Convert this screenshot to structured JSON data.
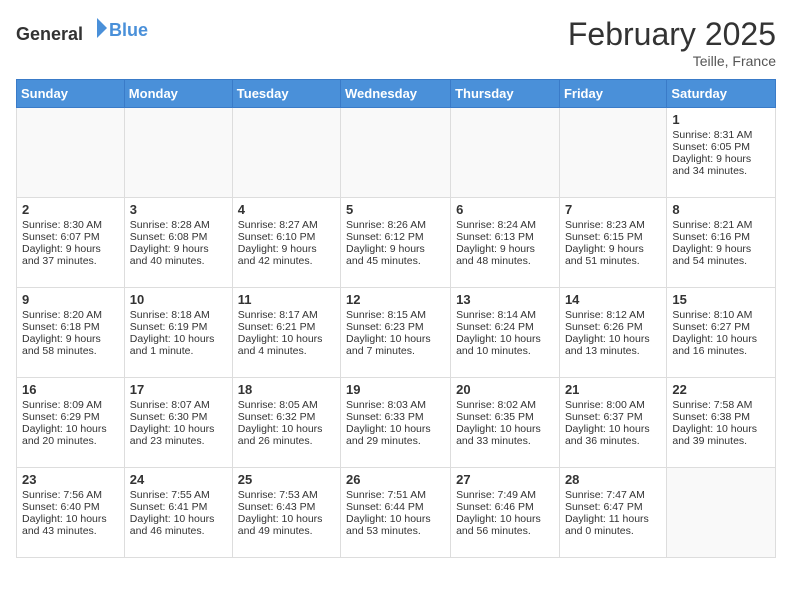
{
  "header": {
    "logo_general": "General",
    "logo_blue": "Blue",
    "month": "February 2025",
    "location": "Teille, France"
  },
  "days_of_week": [
    "Sunday",
    "Monday",
    "Tuesday",
    "Wednesday",
    "Thursday",
    "Friday",
    "Saturday"
  ],
  "weeks": [
    [
      {
        "day": "",
        "info": ""
      },
      {
        "day": "",
        "info": ""
      },
      {
        "day": "",
        "info": ""
      },
      {
        "day": "",
        "info": ""
      },
      {
        "day": "",
        "info": ""
      },
      {
        "day": "",
        "info": ""
      },
      {
        "day": "1",
        "info": "Sunrise: 8:31 AM\nSunset: 6:05 PM\nDaylight: 9 hours and 34 minutes."
      }
    ],
    [
      {
        "day": "2",
        "info": "Sunrise: 8:30 AM\nSunset: 6:07 PM\nDaylight: 9 hours and 37 minutes."
      },
      {
        "day": "3",
        "info": "Sunrise: 8:28 AM\nSunset: 6:08 PM\nDaylight: 9 hours and 40 minutes."
      },
      {
        "day": "4",
        "info": "Sunrise: 8:27 AM\nSunset: 6:10 PM\nDaylight: 9 hours and 42 minutes."
      },
      {
        "day": "5",
        "info": "Sunrise: 8:26 AM\nSunset: 6:12 PM\nDaylight: 9 hours and 45 minutes."
      },
      {
        "day": "6",
        "info": "Sunrise: 8:24 AM\nSunset: 6:13 PM\nDaylight: 9 hours and 48 minutes."
      },
      {
        "day": "7",
        "info": "Sunrise: 8:23 AM\nSunset: 6:15 PM\nDaylight: 9 hours and 51 minutes."
      },
      {
        "day": "8",
        "info": "Sunrise: 8:21 AM\nSunset: 6:16 PM\nDaylight: 9 hours and 54 minutes."
      }
    ],
    [
      {
        "day": "9",
        "info": "Sunrise: 8:20 AM\nSunset: 6:18 PM\nDaylight: 9 hours and 58 minutes."
      },
      {
        "day": "10",
        "info": "Sunrise: 8:18 AM\nSunset: 6:19 PM\nDaylight: 10 hours and 1 minute."
      },
      {
        "day": "11",
        "info": "Sunrise: 8:17 AM\nSunset: 6:21 PM\nDaylight: 10 hours and 4 minutes."
      },
      {
        "day": "12",
        "info": "Sunrise: 8:15 AM\nSunset: 6:23 PM\nDaylight: 10 hours and 7 minutes."
      },
      {
        "day": "13",
        "info": "Sunrise: 8:14 AM\nSunset: 6:24 PM\nDaylight: 10 hours and 10 minutes."
      },
      {
        "day": "14",
        "info": "Sunrise: 8:12 AM\nSunset: 6:26 PM\nDaylight: 10 hours and 13 minutes."
      },
      {
        "day": "15",
        "info": "Sunrise: 8:10 AM\nSunset: 6:27 PM\nDaylight: 10 hours and 16 minutes."
      }
    ],
    [
      {
        "day": "16",
        "info": "Sunrise: 8:09 AM\nSunset: 6:29 PM\nDaylight: 10 hours and 20 minutes."
      },
      {
        "day": "17",
        "info": "Sunrise: 8:07 AM\nSunset: 6:30 PM\nDaylight: 10 hours and 23 minutes."
      },
      {
        "day": "18",
        "info": "Sunrise: 8:05 AM\nSunset: 6:32 PM\nDaylight: 10 hours and 26 minutes."
      },
      {
        "day": "19",
        "info": "Sunrise: 8:03 AM\nSunset: 6:33 PM\nDaylight: 10 hours and 29 minutes."
      },
      {
        "day": "20",
        "info": "Sunrise: 8:02 AM\nSunset: 6:35 PM\nDaylight: 10 hours and 33 minutes."
      },
      {
        "day": "21",
        "info": "Sunrise: 8:00 AM\nSunset: 6:37 PM\nDaylight: 10 hours and 36 minutes."
      },
      {
        "day": "22",
        "info": "Sunrise: 7:58 AM\nSunset: 6:38 PM\nDaylight: 10 hours and 39 minutes."
      }
    ],
    [
      {
        "day": "23",
        "info": "Sunrise: 7:56 AM\nSunset: 6:40 PM\nDaylight: 10 hours and 43 minutes."
      },
      {
        "day": "24",
        "info": "Sunrise: 7:55 AM\nSunset: 6:41 PM\nDaylight: 10 hours and 46 minutes."
      },
      {
        "day": "25",
        "info": "Sunrise: 7:53 AM\nSunset: 6:43 PM\nDaylight: 10 hours and 49 minutes."
      },
      {
        "day": "26",
        "info": "Sunrise: 7:51 AM\nSunset: 6:44 PM\nDaylight: 10 hours and 53 minutes."
      },
      {
        "day": "27",
        "info": "Sunrise: 7:49 AM\nSunset: 6:46 PM\nDaylight: 10 hours and 56 minutes."
      },
      {
        "day": "28",
        "info": "Sunrise: 7:47 AM\nSunset: 6:47 PM\nDaylight: 11 hours and 0 minutes."
      },
      {
        "day": "",
        "info": ""
      }
    ]
  ]
}
